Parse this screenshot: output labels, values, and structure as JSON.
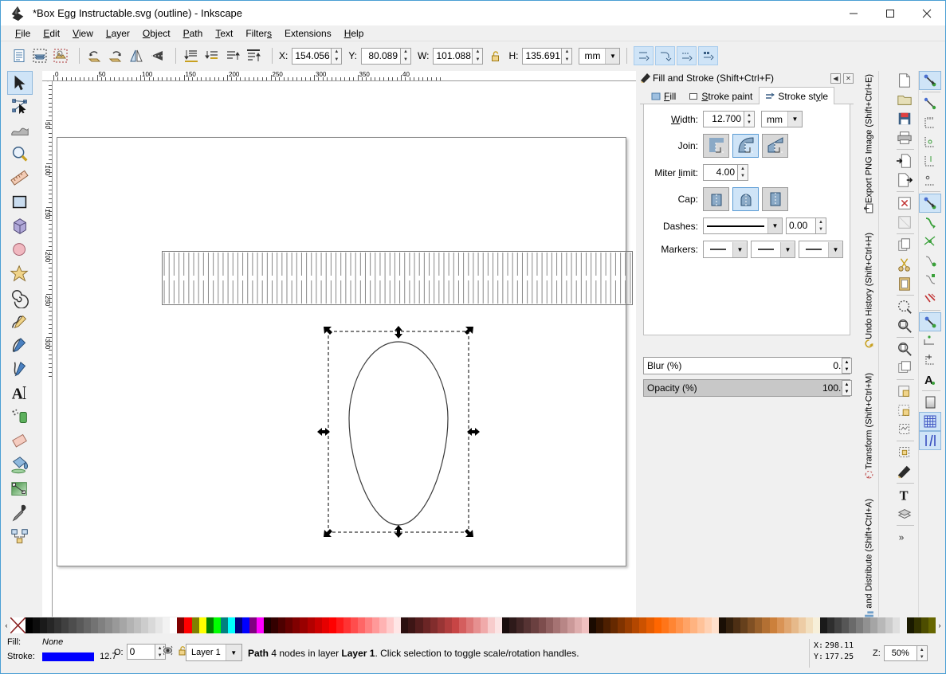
{
  "window": {
    "title": "*Box Egg Instructable.svg (outline) - Inkscape",
    "logo_icon": "inkscape-logo-icon",
    "minimize_label": "—",
    "maximize_label": "☐",
    "close_label": "✕"
  },
  "menubar": {
    "items": [
      {
        "label": "File",
        "accel": "F"
      },
      {
        "label": "Edit",
        "accel": "E"
      },
      {
        "label": "View",
        "accel": "V"
      },
      {
        "label": "Layer",
        "accel": "L"
      },
      {
        "label": "Object",
        "accel": "O"
      },
      {
        "label": "Path",
        "accel": "P"
      },
      {
        "label": "Text",
        "accel": "T"
      },
      {
        "label": "Filters",
        "accel": "s"
      },
      {
        "label": "Extensions",
        "accel": "N"
      },
      {
        "label": "Help",
        "accel": "H"
      }
    ]
  },
  "command_toolbar": {
    "icons": [
      {
        "name": "select-all-icon"
      },
      {
        "name": "select-all-in-all-layers-icon"
      },
      {
        "name": "select-same-icon"
      },
      {
        "name": "rotate-90-ccw-icon"
      },
      {
        "name": "rotate-90-cw-icon"
      },
      {
        "name": "flip-horizontal-icon"
      },
      {
        "name": "flip-vertical-icon"
      },
      {
        "name": "lower-to-bottom-icon"
      },
      {
        "name": "lower-one-step-icon"
      },
      {
        "name": "raise-one-step-icon"
      },
      {
        "name": "raise-to-top-icon"
      }
    ],
    "x_label": "X:",
    "x_value": "154.056",
    "y_label": "Y:",
    "y_value": "80.089",
    "w_label": "W:",
    "w_value": "101.088",
    "lock_icon": "lock-open-icon",
    "h_label": "H:",
    "h_value": "135.691",
    "unit": "mm",
    "affect_toggles": [
      {
        "name": "affect-stroke-width-toggle"
      },
      {
        "name": "affect-rounded-corners-toggle"
      },
      {
        "name": "affect-gradients-toggle"
      },
      {
        "name": "affect-patterns-toggle"
      }
    ]
  },
  "toolbox": {
    "tools": [
      {
        "name": "selector-tool",
        "active": true
      },
      {
        "name": "node-editor-tool",
        "active": false
      },
      {
        "name": "tweak-tool",
        "active": false
      },
      {
        "name": "zoom-tool",
        "active": false
      },
      {
        "name": "measure-tool",
        "active": false
      },
      {
        "name": "rectangle-tool",
        "active": false
      },
      {
        "name": "3d-box-tool",
        "active": false
      },
      {
        "name": "ellipse-tool",
        "active": false
      },
      {
        "name": "star-tool",
        "active": false
      },
      {
        "name": "spiral-tool",
        "active": false
      },
      {
        "name": "pencil-tool",
        "active": false
      },
      {
        "name": "bezier-pen-tool",
        "active": false
      },
      {
        "name": "calligraphy-tool",
        "active": false
      },
      {
        "name": "text-tool",
        "active": false
      },
      {
        "name": "spray-tool",
        "active": false
      },
      {
        "name": "eraser-tool",
        "active": false
      },
      {
        "name": "paint-bucket-tool",
        "active": false
      },
      {
        "name": "gradient-tool",
        "active": false
      },
      {
        "name": "dropper-tool",
        "active": false
      },
      {
        "name": "connector-tool",
        "active": false
      }
    ]
  },
  "rulers": {
    "unit": "mm",
    "top_labels": [
      "0",
      "50",
      "100",
      "150",
      "200",
      "250",
      "300",
      "350",
      "40"
    ],
    "left_labels": [
      "0",
      "50",
      "100",
      "150",
      "200",
      "250",
      "300"
    ]
  },
  "canvas": {
    "objects": [
      {
        "name": "living-hinge-rectangle",
        "description": "rectangle filled with vertical hinge slots"
      },
      {
        "name": "egg-path",
        "description": "egg outline path, selected"
      }
    ],
    "selection": {
      "handles": "scale-arrows",
      "dashed_bbox": true
    }
  },
  "dock": {
    "title": "Fill and Stroke (Shift+Ctrl+F)",
    "title_icon": "fill-stroke-icon",
    "collapse_label": "◀",
    "close_label": "✕",
    "tabs": [
      {
        "label": "Fill",
        "accel": "F",
        "icon": "fill-swatch-icon",
        "active": false
      },
      {
        "label": "Stroke paint",
        "accel": "S",
        "icon": "stroke-paint-icon",
        "active": false
      },
      {
        "label": "Stroke style",
        "accel": "y",
        "icon": "stroke-style-icon",
        "active": true
      }
    ],
    "stroke_style": {
      "width_label": "Width:",
      "width_value": "12.700",
      "width_unit": "mm",
      "join_label": "Join:",
      "join_options": [
        {
          "name": "join-miter",
          "active": false
        },
        {
          "name": "join-round",
          "active": true
        },
        {
          "name": "join-bevel",
          "active": false
        }
      ],
      "miter_label": "Miter limit:",
      "miter_value": "4.00",
      "miter_disabled": true,
      "cap_label": "Cap:",
      "cap_options": [
        {
          "name": "cap-butt",
          "active": false
        },
        {
          "name": "cap-round",
          "active": true
        },
        {
          "name": "cap-square",
          "active": false
        }
      ],
      "dashes_label": "Dashes:",
      "dashes_offset": "0.00",
      "markers_label": "Markers:",
      "markers": [
        "none",
        "none",
        "none"
      ]
    },
    "blur": {
      "label": "Blur (%)",
      "value": "0.0"
    },
    "opacity": {
      "label": "Opacity (%)",
      "value": "100.0"
    }
  },
  "vertical_tabs": [
    {
      "label": "Export PNG Image (Shift+Ctrl+E)",
      "icon": "export-png-icon"
    },
    {
      "label": "Undo History (Shift+Ctrl+H)",
      "icon": "undo-history-icon"
    },
    {
      "label": "Transform (Shift+Ctrl+M)",
      "icon": "transform-icon"
    },
    {
      "label": "and Distribute (Shift+Ctrl+A)",
      "icon": "align-distribute-icon"
    }
  ],
  "right_toolbar_commands": [
    {
      "name": "new-document-icon"
    },
    {
      "name": "open-document-icon"
    },
    {
      "name": "save-document-icon"
    },
    {
      "name": "print-document-icon"
    },
    {
      "name": "import-icon"
    },
    {
      "name": "export-icon"
    },
    {
      "name": "undo-icon"
    },
    {
      "name": "redo-icon"
    },
    {
      "name": "copy-icon"
    },
    {
      "name": "cut-icon"
    },
    {
      "name": "paste-icon"
    },
    {
      "name": "zoom-selection-icon"
    },
    {
      "name": "zoom-drawing-icon"
    },
    {
      "name": "zoom-page-icon"
    },
    {
      "name": "duplicate-icon"
    },
    {
      "name": "group-icon"
    },
    {
      "name": "ungroup-icon"
    },
    {
      "name": "object-properties-icon"
    },
    {
      "name": "xml-editor-icon"
    },
    {
      "name": "fill-stroke-dialog-icon"
    },
    {
      "name": "text-properties-icon"
    },
    {
      "name": "layers-dialog-icon"
    },
    {
      "name": "more-icon"
    }
  ],
  "snap_toolbar": [
    {
      "name": "enable-snapping-toggle",
      "active": true
    },
    {
      "name": "snap-bounding-box-icon",
      "active": false
    },
    {
      "name": "snap-bbox-edges-icon",
      "active": false
    },
    {
      "name": "snap-bbox-corners-icon",
      "active": false
    },
    {
      "name": "snap-bbox-edge-midpoints-icon",
      "active": false
    },
    {
      "name": "snap-bbox-centers-icon",
      "active": false
    },
    {
      "name": "snap-nodes-paths-icon",
      "active": true
    },
    {
      "name": "snap-paths-icon",
      "active": false
    },
    {
      "name": "snap-path-intersections-icon",
      "active": false
    },
    {
      "name": "snap-cusp-nodes-icon",
      "active": false
    },
    {
      "name": "snap-smooth-nodes-icon",
      "active": false
    },
    {
      "name": "snap-midpoints-icon",
      "active": false
    },
    {
      "name": "snap-others-icon",
      "active": true
    },
    {
      "name": "snap-object-centers-icon",
      "active": false
    },
    {
      "name": "snap-rotation-centers-icon",
      "active": false
    },
    {
      "name": "snap-text-baseline-icon",
      "active": false
    },
    {
      "name": "snap-page-border-icon",
      "active": false
    },
    {
      "name": "snap-grid-icon",
      "active": true
    },
    {
      "name": "snap-guides-icon",
      "active": true
    }
  ],
  "palette": {
    "prev_label": "‹",
    "next_label": "›",
    "colors": [
      "#5c0000",
      "#000000",
      "#0d0d0d",
      "#1a1a1a",
      "#262626",
      "#333333",
      "#404040",
      "#4d4d4d",
      "#595959",
      "#666666",
      "#737373",
      "#808080",
      "#8c8c8c",
      "#999999",
      "#a6a6a6",
      "#b3b3b3",
      "#bfbfbf",
      "#cccccc",
      "#d9d9d9",
      "#e6e6e6",
      "#f2f2f2",
      "#ffffff",
      "#800000",
      "#ff0000",
      "#808000",
      "#ffff00",
      "#008000",
      "#00ff00",
      "#008080",
      "#00ffff",
      "#000080",
      "#0000ff",
      "#800080",
      "#ff00ff",
      "#1a0000",
      "#330000",
      "#4d0000",
      "#660000",
      "#800000",
      "#990000",
      "#b30000",
      "#cc0000",
      "#e60000",
      "#ff0000",
      "#ff1a1a",
      "#ff3333",
      "#ff4d4d",
      "#ff6666",
      "#ff8080",
      "#ff9999",
      "#ffb3b3",
      "#ffcccc",
      "#ffe6e6",
      "#2b0f0f",
      "#3d1515",
      "#541d1d",
      "#6b2525",
      "#822d2d",
      "#993535",
      "#b03d3d",
      "#c74545",
      "#d45e5e",
      "#dd7777",
      "#e69090",
      "#f0aaaa",
      "#f7cccc",
      "#fbe4e4",
      "#1a0d0d",
      "#2e1a1a",
      "#422626",
      "#563333",
      "#6a4040",
      "#7d4d4d",
      "#916060",
      "#a57373",
      "#b88686",
      "#cb9999",
      "#deadad",
      "#f0c0c0",
      "#1a0a00",
      "#331400",
      "#4d1f00",
      "#662900",
      "#803300",
      "#993d00",
      "#b34700",
      "#cc5200",
      "#e65c00",
      "#ff6600",
      "#ff7519",
      "#ff8533",
      "#ff944d",
      "#ffa366",
      "#ffb380",
      "#ffc299",
      "#ffd1b3",
      "#ffe0cc",
      "#1a0f05",
      "#33200d",
      "#4d2f14",
      "#66401c",
      "#805024",
      "#99602b",
      "#b37033",
      "#cc803b",
      "#d99355",
      "#e0a670",
      "#e6b98a",
      "#edcca5",
      "#f2dfbf",
      "#f7efd9",
      "#1a1a1a",
      "#2e2e2e",
      "#424242",
      "#565656",
      "#6a6a6a",
      "#7d7d7d",
      "#919191",
      "#a5a5a5",
      "#b8b8b8",
      "#cbcbcb",
      "#dedede",
      "#efefef",
      "#1a1a00",
      "#333300",
      "#4d4d00",
      "#666600"
    ]
  },
  "statusbar": {
    "fill_label": "Fill:",
    "fill_value": "None",
    "stroke_label": "Stroke:",
    "stroke_color": "#0000ff",
    "stroke_width": "12.7",
    "opacity_label": "O:",
    "opacity_value": "0",
    "eye_icon": "layer-visible-icon",
    "lock_icon": "layer-unlocked-icon",
    "layer_name": "Layer 1",
    "message_bold1": "Path",
    "message_mid": " 4 nodes in layer ",
    "message_bold2": "Layer 1",
    "message_tail": ". Click selection to toggle scale/rotation handles.",
    "cursor_x_label": "X:",
    "cursor_x": "298.11",
    "cursor_y_label": "Y:",
    "cursor_y": "177.25",
    "zoom_label": "Z:",
    "zoom_value": "50%"
  }
}
